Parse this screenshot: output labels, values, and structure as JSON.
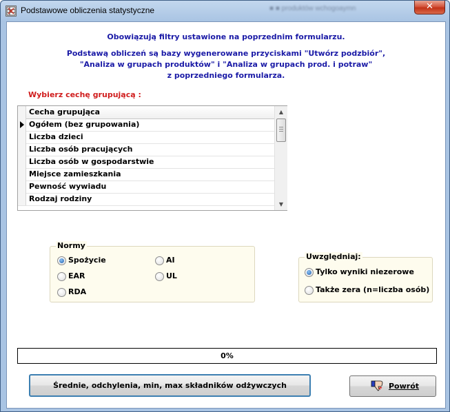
{
  "window": {
    "title": "Podstawowe obliczenia statystyczne",
    "close_glyph": "✕",
    "background_title": "■ ■ produktów wchogoaymn"
  },
  "info": {
    "line1": "Obowiązują filtry ustawione na poprzednim formularzu.",
    "line2": "Podstawą obliczeń są bazy wygenerowane przyciskami \"Utwórz podzbiór\",",
    "line3": "\"Analiza w grupach produktów\" i \"Analiza w grupach prod. i potraw\"",
    "line4": "z poprzedniego formularza."
  },
  "grouping": {
    "label": "Wybierz cechę grupującą :",
    "column_header": "Cecha grupująca",
    "selected_index": 0,
    "rows": [
      "Ogółem (bez grupowania)",
      "Liczba dzieci",
      "Liczba osób pracujących",
      "Liczba osób w gospodarstwie",
      "Miejsce zamieszkania",
      "Pewność wywiadu",
      "Rodzaj rodziny"
    ]
  },
  "norms": {
    "title": "Normy",
    "options": [
      "Spożycie",
      "AI",
      "EAR",
      "UL",
      "RDA"
    ],
    "selected": "Spożycie"
  },
  "include": {
    "title": "Uwzględniaj:",
    "options": [
      "Tylko wyniki niezerowe",
      "Także zera (n=liczba osób)"
    ],
    "selected": "Tylko wyniki niezerowe"
  },
  "progress": {
    "text": "0%",
    "value": 0
  },
  "buttons": {
    "compute": "Średnie, odchylenia, min, max składników odżywczych",
    "back": "Powrót"
  },
  "icons": {
    "window_icon": "table-icon",
    "back_icon": "thumbs-down-icon",
    "arrow": "row-selector-arrow-icon"
  }
}
